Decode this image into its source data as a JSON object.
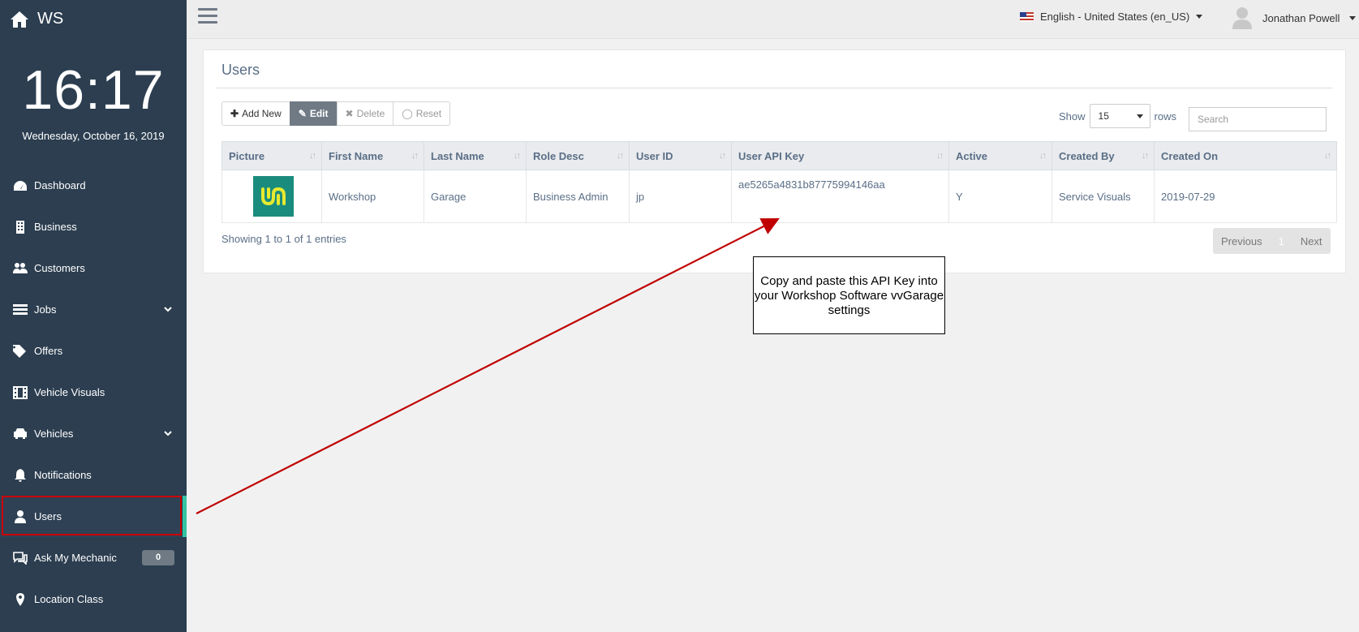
{
  "sidebar": {
    "brand": "WS",
    "clock": "16:17",
    "date": "Wednesday, October 16, 2019",
    "items": [
      {
        "label": "Dashboard",
        "icon": "dashboard-icon"
      },
      {
        "label": "Business",
        "icon": "building-icon"
      },
      {
        "label": "Customers",
        "icon": "users-icon"
      },
      {
        "label": "Jobs",
        "icon": "list-icon"
      },
      {
        "label": "Offers",
        "icon": "tags-icon"
      },
      {
        "label": "Vehicle Visuals",
        "icon": "film-icon"
      },
      {
        "label": "Vehicles",
        "icon": "car-icon"
      },
      {
        "label": "Notifications",
        "icon": "bell-icon"
      },
      {
        "label": "Users",
        "icon": "user-icon"
      },
      {
        "label": "Ask My Mechanic",
        "icon": "chat-icon"
      },
      {
        "label": "Location Class",
        "icon": "map-marker-icon"
      }
    ],
    "ask_badge": "0",
    "accent": "#33c3a1",
    "bg": "#2c3e50"
  },
  "topbar": {
    "language": "English - United States  (en_US)",
    "user_name": "Jonathan Powell"
  },
  "panel": {
    "title": "Users",
    "buttons": {
      "add": "Add New",
      "edit": "Edit",
      "delete": "Delete",
      "reset": "Reset"
    },
    "show_label": "Show",
    "rows_value": "15",
    "rows_label": "rows",
    "search_placeholder": "Search",
    "columns": [
      "Picture",
      "First Name",
      "Last Name",
      "Role Desc",
      "User ID",
      "User API Key",
      "Active",
      "Created By",
      "Created On"
    ],
    "rows": [
      {
        "first_name": "Workshop",
        "last_name": "Garage",
        "role": "Business Admin",
        "user_id": "jp",
        "api_key": "ae5265a4831b87775994146aa",
        "active": "Y",
        "created_by": "Service Visuals",
        "created_on": "2019-07-29"
      }
    ],
    "info": "Showing 1 to 1 of 1 entries",
    "pager": {
      "prev": "Previous",
      "page": "1",
      "next": "Next"
    }
  },
  "annotation": {
    "callout": "Copy and paste this API Key into your Workshop Software vvGarage settings",
    "arrow_color": "#c00000"
  }
}
